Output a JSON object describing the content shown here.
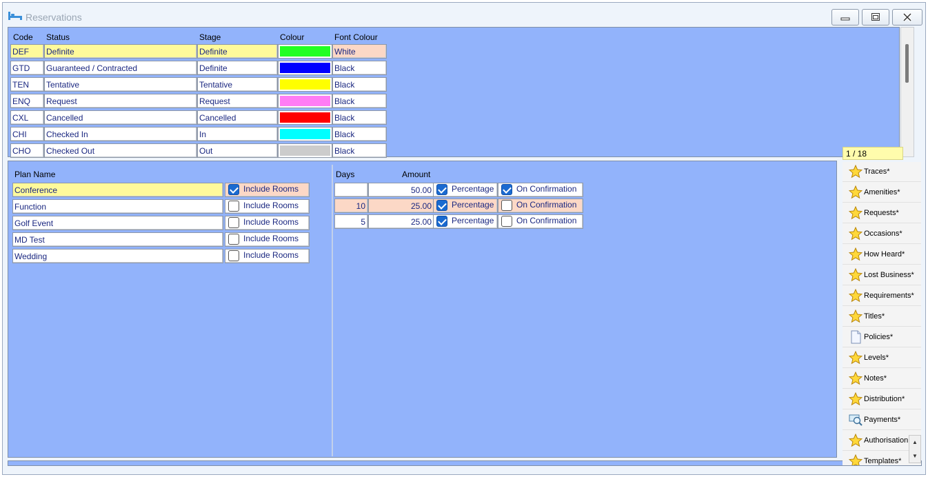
{
  "window": {
    "title": "Reservations",
    "minimize_icon": "minimize-icon",
    "maximize_icon": "maximize-icon",
    "close_icon": "close-icon"
  },
  "status_table": {
    "headers": {
      "code": "Code",
      "status": "Status",
      "stage": "Stage",
      "colour": "Colour",
      "font_colour": "Font Colour"
    },
    "rows": [
      {
        "code": "DEF",
        "status": "Definite",
        "stage": "Definite",
        "colour": "#22ff22",
        "font_colour": "White"
      },
      {
        "code": "GTD",
        "status": "Guaranteed / Contracted",
        "stage": "Definite",
        "colour": "#0000ff",
        "font_colour": "Black"
      },
      {
        "code": "TEN",
        "status": "Tentative",
        "stage": "Tentative",
        "colour": "#ffff00",
        "font_colour": "Black"
      },
      {
        "code": "ENQ",
        "status": "Request",
        "stage": "Request",
        "colour": "#ff7cf5",
        "font_colour": "Black"
      },
      {
        "code": "CXL",
        "status": "Cancelled",
        "stage": "Cancelled",
        "colour": "#ff0000",
        "font_colour": "Black"
      },
      {
        "code": "CHI",
        "status": "Checked In",
        "stage": "In",
        "colour": "#00ffff",
        "font_colour": "Black"
      },
      {
        "code": "CHO",
        "status": "Checked Out",
        "stage": "Out",
        "colour": "#cccccc",
        "font_colour": "Black"
      }
    ],
    "pager": "1 / 18"
  },
  "plans": {
    "header": "Plan Name",
    "include_label": "Include Rooms",
    "rows": [
      {
        "name": "Conference",
        "include": true
      },
      {
        "name": "Function",
        "include": false
      },
      {
        "name": "Golf Event",
        "include": false
      },
      {
        "name": "MD Test",
        "include": false
      },
      {
        "name": "Wedding",
        "include": false
      }
    ]
  },
  "terms": {
    "headers": {
      "days": "Days",
      "amount": "Amount"
    },
    "percentage_label": "Percentage",
    "confirmation_label": "On Confirmation",
    "rows": [
      {
        "days": "",
        "amount": "50.00",
        "percentage": true,
        "on_confirmation": true
      },
      {
        "days": "10",
        "amount": "25.00",
        "percentage": true,
        "on_confirmation": false
      },
      {
        "days": "5",
        "amount": "25.00",
        "percentage": true,
        "on_confirmation": false
      }
    ]
  },
  "sidebar": {
    "items": [
      {
        "label": "Traces*",
        "icon": "star-icon"
      },
      {
        "label": "Amenities*",
        "icon": "star-icon"
      },
      {
        "label": "Requests*",
        "icon": "star-icon"
      },
      {
        "label": "Occasions*",
        "icon": "star-icon"
      },
      {
        "label": "How Heard*",
        "icon": "star-icon"
      },
      {
        "label": "Lost Business*",
        "icon": "star-icon"
      },
      {
        "label": "Requirements*",
        "icon": "star-icon"
      },
      {
        "label": "Titles*",
        "icon": "star-icon"
      },
      {
        "label": "Policies*",
        "icon": "document-icon"
      },
      {
        "label": "Levels*",
        "icon": "star-icon"
      },
      {
        "label": "Notes*",
        "icon": "star-icon"
      },
      {
        "label": "Distribution*",
        "icon": "star-icon"
      },
      {
        "label": "Payments*",
        "icon": "payment-search-icon"
      },
      {
        "label": "Authorisation",
        "icon": "star-icon"
      },
      {
        "label": "Templates*",
        "icon": "star-icon"
      }
    ]
  },
  "colors": {
    "panel_bg": "#92b3fb",
    "selected_row": "#fffa9b",
    "highlight_row": "#fcd8c6",
    "cell_text": "#1a2780",
    "checkbox_on": "#1a6ad0"
  }
}
